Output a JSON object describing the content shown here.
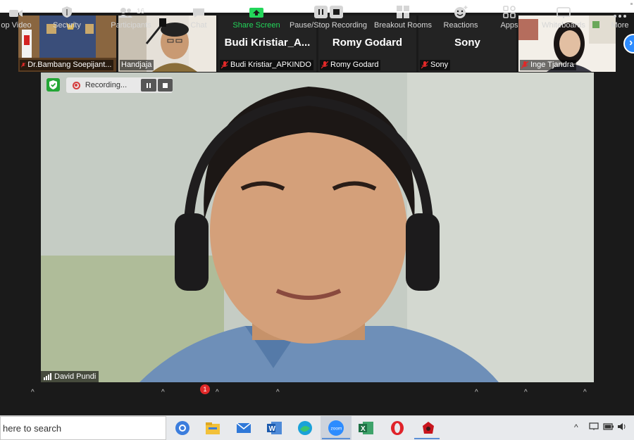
{
  "meeting": {
    "recording_label": "Recording...",
    "speaker_name": "David Pundi"
  },
  "participants": [
    {
      "name": "Dr.Bambang Soepijant...",
      "mic": "muted",
      "kind": "video"
    },
    {
      "name": "Handjaja",
      "mic": "on",
      "kind": "video"
    },
    {
      "name": "Budi Kristiar_APKINDO",
      "display": "Budi  Kristiar_A...",
      "mic": "muted",
      "kind": "name"
    },
    {
      "name": "Romy Godard",
      "display": "Romy Godard",
      "mic": "muted",
      "kind": "name"
    },
    {
      "name": "Sony",
      "display": "Sony",
      "mic": "muted",
      "kind": "name"
    },
    {
      "name": "Inge Tjandra",
      "mic": "muted",
      "kind": "video"
    }
  ],
  "toolbar": {
    "stop_video": "op Video",
    "security": "Security",
    "participants": "Participants",
    "participants_count": "16",
    "chat": "Chat",
    "chat_badge": "1",
    "share_screen": "Share Screen",
    "pause_stop_recording": "Pause/Stop Recording",
    "breakout_rooms": "Breakout Rooms",
    "reactions": "Reactions",
    "apps": "Apps",
    "whiteboards": "Whiteboards",
    "more": "More"
  },
  "taskbar": {
    "search_text": "here to search",
    "apps": [
      "chrome-like-icon",
      "file-explorer-icon",
      "mail-icon",
      "word-icon",
      "edge-icon",
      "zoom-icon",
      "excel-icon",
      "opera-icon",
      "game-icon"
    ]
  },
  "colors": {
    "zoom_dark": "#1a1a1a",
    "share_green": "#23d65a",
    "mic_off_red": "#e02828",
    "zoom_blue": "#2d8cff"
  }
}
